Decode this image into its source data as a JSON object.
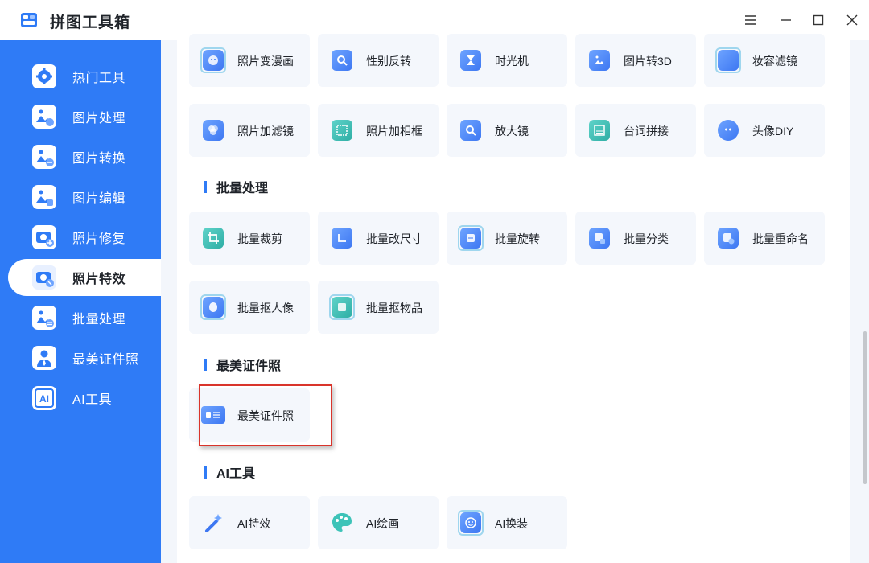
{
  "app": {
    "title": "拼图工具箱"
  },
  "sidebar": {
    "items": [
      {
        "label": "热门工具",
        "icon": "gear-icon"
      },
      {
        "label": "图片处理",
        "icon": "image-process-icon"
      },
      {
        "label": "图片转换",
        "icon": "image-convert-icon"
      },
      {
        "label": "图片编辑",
        "icon": "image-edit-icon"
      },
      {
        "label": "照片修复",
        "icon": "photo-repair-icon"
      },
      {
        "label": "照片特效",
        "icon": "photo-effect-icon",
        "active": true
      },
      {
        "label": "批量处理",
        "icon": "batch-process-icon"
      },
      {
        "label": "最美证件照",
        "icon": "id-photo-icon"
      },
      {
        "label": "AI工具",
        "icon": "ai-icon"
      }
    ]
  },
  "effects": {
    "row1": [
      "照片变漫画",
      "性别反转",
      "时光机",
      "图片转3D",
      "妆容滤镜"
    ],
    "row2": [
      "照片加滤镜",
      "照片加相框",
      "放大镜",
      "台词拼接",
      "头像DIY"
    ]
  },
  "batch": {
    "title": "批量处理",
    "row1": [
      "批量裁剪",
      "批量改尺寸",
      "批量旋转",
      "批量分类",
      "批量重命名"
    ],
    "row2": [
      "批量抠人像",
      "批量抠物品"
    ]
  },
  "idphoto": {
    "title": "最美证件照",
    "items": [
      "最美证件照"
    ]
  },
  "ai": {
    "title": "AI工具",
    "items": [
      "AI特效",
      "AI绘画",
      "AI换装"
    ]
  },
  "colors": {
    "accent": "#2f7bf6",
    "highlight": "#d9342b"
  }
}
